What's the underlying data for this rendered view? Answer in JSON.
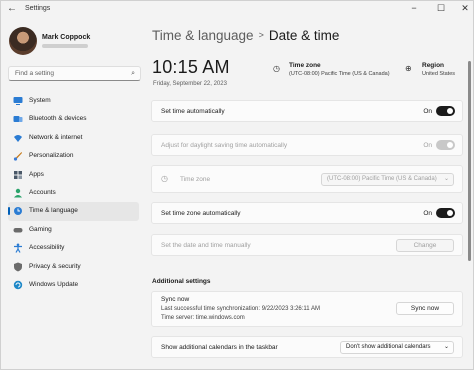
{
  "window": {
    "title": "Settings",
    "back_icon": "arrow-left-icon"
  },
  "user": {
    "name": "Mark Coppock"
  },
  "search": {
    "placeholder": "Find a setting"
  },
  "sidebar": {
    "items": [
      {
        "label": "System",
        "icon": "monitor-icon",
        "color": "#2b7cd3"
      },
      {
        "label": "Bluetooth & devices",
        "icon": "bluetooth-icon",
        "color": "#2b7cd3"
      },
      {
        "label": "Network & internet",
        "icon": "wifi-icon",
        "color": "#2b7cd3"
      },
      {
        "label": "Personalization",
        "icon": "brush-icon",
        "color": "#c67a1b"
      },
      {
        "label": "Apps",
        "icon": "apps-icon",
        "color": "#4a5868"
      },
      {
        "label": "Accounts",
        "icon": "person-icon",
        "color": "#2aa36b"
      },
      {
        "label": "Time & language",
        "icon": "globe-clock-icon",
        "color": "#2b7cd3",
        "active": true
      },
      {
        "label": "Gaming",
        "icon": "controller-icon",
        "color": "#6b6b6b"
      },
      {
        "label": "Accessibility",
        "icon": "accessibility-icon",
        "color": "#2b7cd3"
      },
      {
        "label": "Privacy & security",
        "icon": "shield-icon",
        "color": "#6b6b6b"
      },
      {
        "label": "Windows Update",
        "icon": "update-icon",
        "color": "#1e88c8"
      }
    ]
  },
  "breadcrumb": {
    "parent": "Time & language",
    "separator": ">",
    "current": "Date & time"
  },
  "clock": {
    "time": "10:15 AM",
    "date": "Friday, September 22, 2023"
  },
  "timezone_summary": {
    "title": "Time zone",
    "value": "(UTC-08:00) Pacific Time (US & Canada)"
  },
  "region_summary": {
    "title": "Region",
    "value": "United States"
  },
  "settings": {
    "set_time_auto": {
      "label": "Set time automatically",
      "state": "On"
    },
    "dst": {
      "label": "Adjust for daylight saving time automatically",
      "state": "On"
    },
    "time_zone": {
      "label": "Time zone",
      "value": "(UTC-08:00) Pacific Time (US & Canada)"
    },
    "set_tz_auto": {
      "label": "Set time zone automatically",
      "state": "On"
    },
    "manual": {
      "label": "Set the date and time manually",
      "button": "Change"
    }
  },
  "additional": {
    "heading": "Additional settings",
    "sync_title": "Sync now",
    "sync_last": "Last successful time synchronization: 9/22/2023 3:26:11 AM",
    "sync_server": "Time server: time.windows.com",
    "sync_button": "Sync now",
    "calendars_label": "Show additional calendars in the taskbar",
    "calendars_value": "Don't show additional calendars"
  },
  "colors": {
    "accent": "#005fb8",
    "toggle_on": "#1b1b1b"
  }
}
